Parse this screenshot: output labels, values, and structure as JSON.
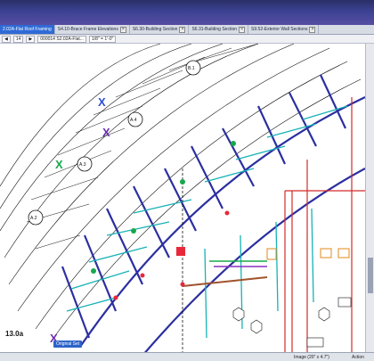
{
  "tabs": [
    {
      "label": "2.02A-Flat Roof Framing",
      "active": true
    },
    {
      "label": "S4.10-Brace Frame Elevations",
      "active": false
    },
    {
      "label": "S6.30-Building Section",
      "active": false
    },
    {
      "label": "S6.31-Building Section",
      "active": false
    },
    {
      "label": "S9.52-Exterior Wall Sections",
      "active": false
    }
  ],
  "toolbar": {
    "page_value": "14",
    "sheet_select": "000014 S2.02A-Flat...",
    "scale_select": "1/8\" = 1'-0\"",
    "prev_label": "◀",
    "next_label": "▶"
  },
  "grid_labels": {
    "a2": "A.2",
    "a3": "A.3",
    "a4": "A.4",
    "b1": "B.1"
  },
  "status": {
    "sheet": "13.0a",
    "original_set": "Original Set",
    "image": "Image (20\" x 4.7\")",
    "action": "Action"
  },
  "colors": {
    "accent": "#2f6bd6",
    "beam_blue": "#2b2fa0",
    "brace_teal": "#17b2b6",
    "wall_red": "#d32b2b",
    "brace_green": "#19a84a",
    "brace_purple": "#8a2fc0",
    "brown": "#a0522d"
  }
}
